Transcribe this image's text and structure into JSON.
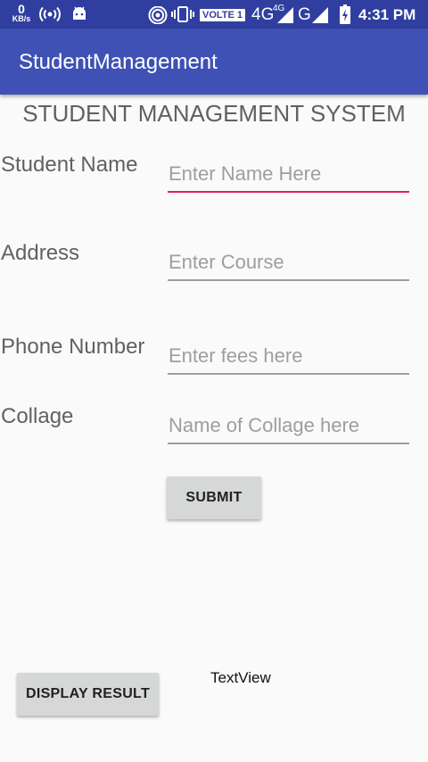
{
  "status_bar": {
    "kb_rate": "0",
    "kb_unit": "KB/s",
    "network_label": "VOLTE 1",
    "network_type": "4G",
    "network_type_small": "4G",
    "network_type_2": "G",
    "time": "4:31 PM"
  },
  "app_bar": {
    "title": "StudentManagement"
  },
  "form": {
    "heading": "STUDENT MANAGEMENT SYSTEM",
    "rows": [
      {
        "label": "Student Name",
        "placeholder": "Enter Name Here"
      },
      {
        "label": "Address",
        "placeholder": "Enter Course"
      },
      {
        "label": "Phone Number",
        "placeholder": "Enter fees here"
      },
      {
        "label": "Collage",
        "placeholder": "Name of Collage here"
      }
    ],
    "submit_label": "SUBMIT"
  },
  "footer": {
    "display_label": "DISPLAY RESULT",
    "textview": "TextView"
  },
  "colors": {
    "status_bar": "#303f9f",
    "app_bar": "#3f51b5",
    "accent": "#e91e63"
  }
}
